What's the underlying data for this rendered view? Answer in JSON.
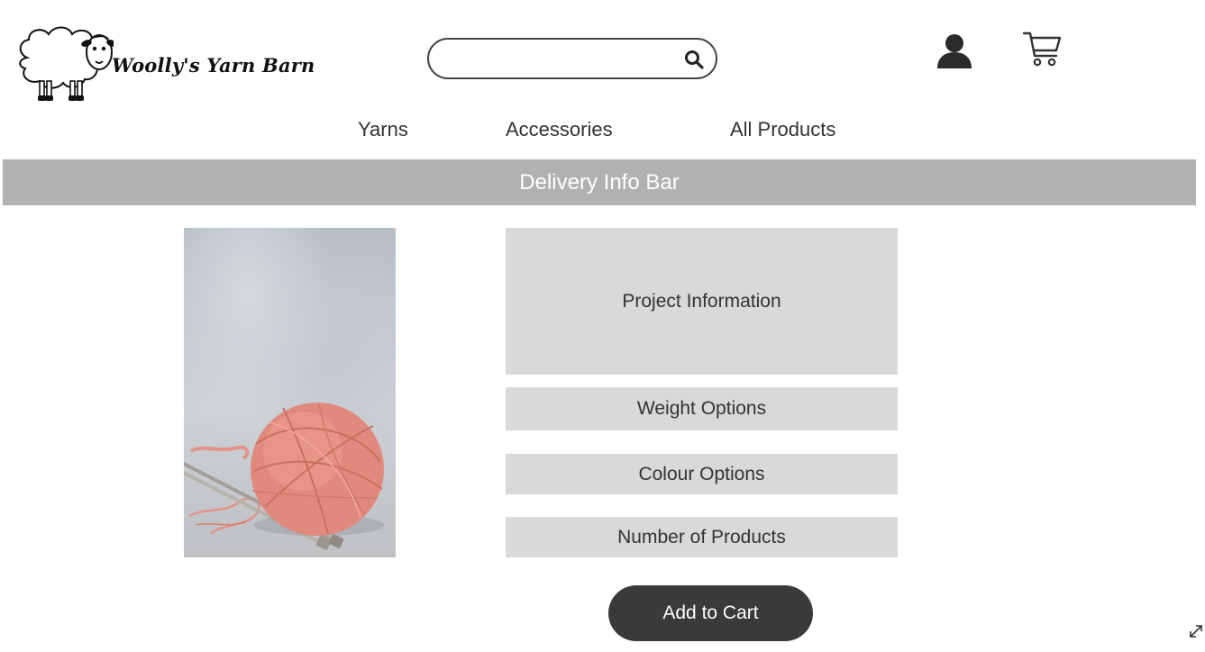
{
  "header": {
    "logo_text": "Woolly's Yarn Barn",
    "search": {
      "placeholder": "",
      "value": ""
    }
  },
  "icons": {
    "search": "search-icon",
    "account": "user-icon",
    "cart": "cart-icon",
    "expand": "expand-icon"
  },
  "nav": {
    "items": [
      {
        "label": "Yarns"
      },
      {
        "label": "Accessories"
      },
      {
        "label": "All Products"
      }
    ]
  },
  "delivery_bar": {
    "text": "Delivery Info Bar"
  },
  "product": {
    "image_alt": "Ball of pink yarn with knitting needles",
    "sections": {
      "project_information": "Project Information",
      "weight_options": "Weight Options",
      "colour_options": "Colour Options",
      "number_of_products": "Number of Products"
    },
    "add_to_cart_label": "Add to Cart"
  },
  "colors": {
    "delivery_bar_bg": "#b1b1b1",
    "option_box_bg": "#d9d9d9",
    "button_bg": "#3a3a3a",
    "yarn": "#e08a7d"
  }
}
